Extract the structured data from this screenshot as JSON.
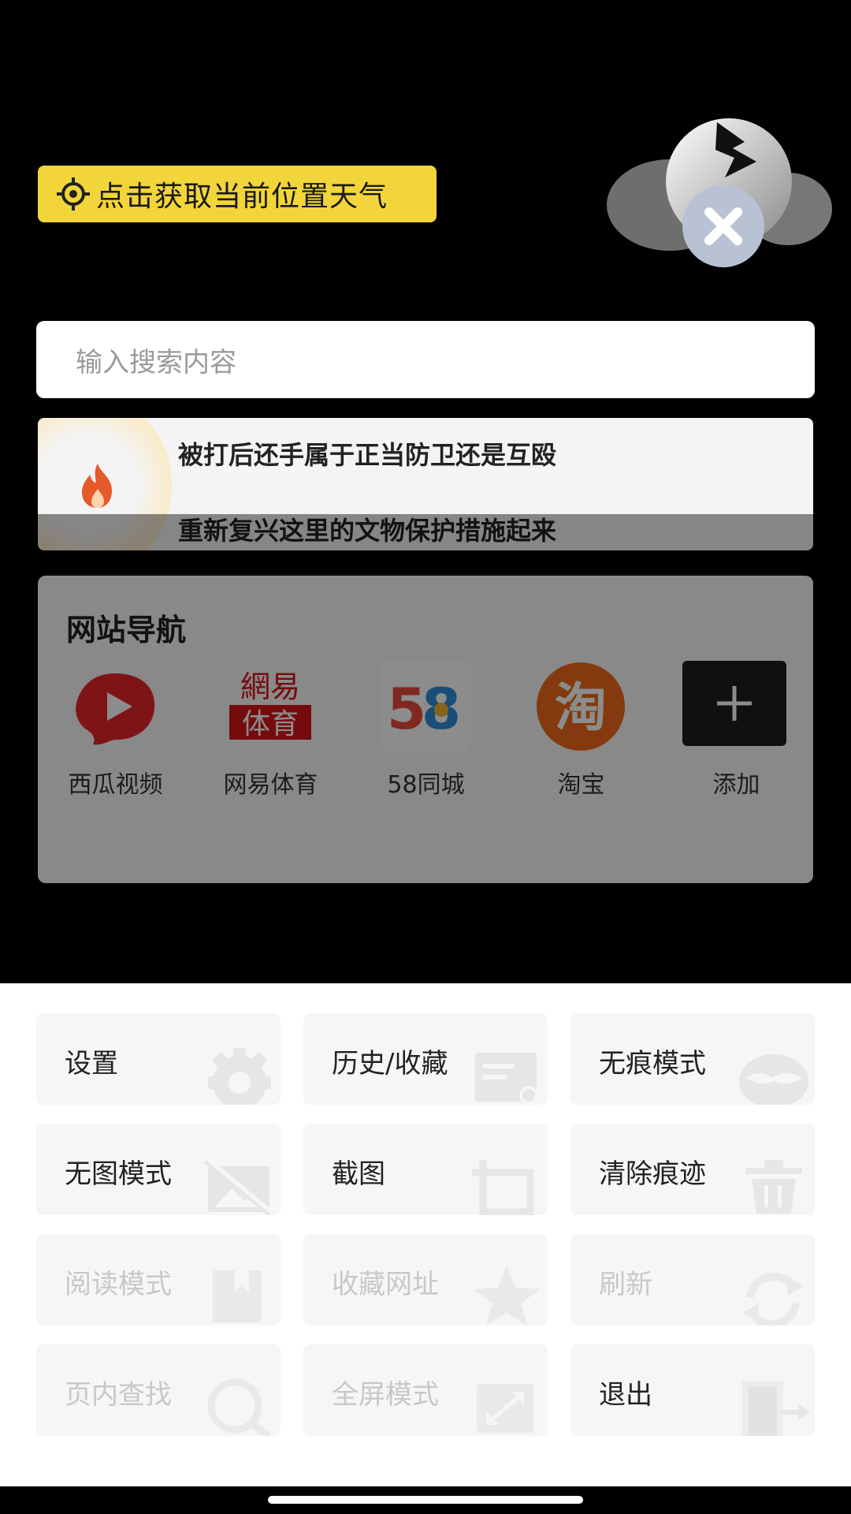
{
  "location": {
    "label": "点击获取当前位置天气"
  },
  "search": {
    "placeholder": "输入搜索内容"
  },
  "hot": {
    "line1": "被打后还手属于正当防卫还是互殴",
    "line2": "重新复兴这里的文物保护措施起来"
  },
  "nav": {
    "title": "网站导航",
    "items": [
      {
        "label": "西瓜视频",
        "icon": "xigua-video-icon"
      },
      {
        "label": "网易体育",
        "icon": "netease-sports-icon"
      },
      {
        "label": "58同城",
        "icon": "58-tongcheng-icon"
      },
      {
        "label": "淘宝",
        "icon": "taobao-icon"
      },
      {
        "label": "添加",
        "icon": "plus-icon"
      }
    ]
  },
  "menu": {
    "items": [
      {
        "label": "设置",
        "icon": "gear-icon",
        "enabled": true
      },
      {
        "label": "历史/收藏",
        "icon": "history-icon",
        "enabled": true
      },
      {
        "label": "无痕模式",
        "icon": "incognito-mask-icon",
        "enabled": true
      },
      {
        "label": "无图模式",
        "icon": "no-image-icon",
        "enabled": true
      },
      {
        "label": "截图",
        "icon": "screenshot-icon",
        "enabled": true
      },
      {
        "label": "清除痕迹",
        "icon": "trash-icon",
        "enabled": true
      },
      {
        "label": "阅读模式",
        "icon": "book-icon",
        "enabled": false
      },
      {
        "label": "收藏网址",
        "icon": "star-icon",
        "enabled": false
      },
      {
        "label": "刷新",
        "icon": "refresh-icon",
        "enabled": false
      },
      {
        "label": "页内查找",
        "icon": "magnifier-icon",
        "enabled": false
      },
      {
        "label": "全屏模式",
        "icon": "fullscreen-icon",
        "enabled": false
      },
      {
        "label": "退出",
        "icon": "exit-door-icon",
        "enabled": true
      }
    ]
  },
  "colors": {
    "accent_yellow": "#f2d53a",
    "overlay": "#000000",
    "taobao_orange": "#f06a1b",
    "xigua_red": "#e8262a",
    "netease_red": "#d8151b"
  }
}
